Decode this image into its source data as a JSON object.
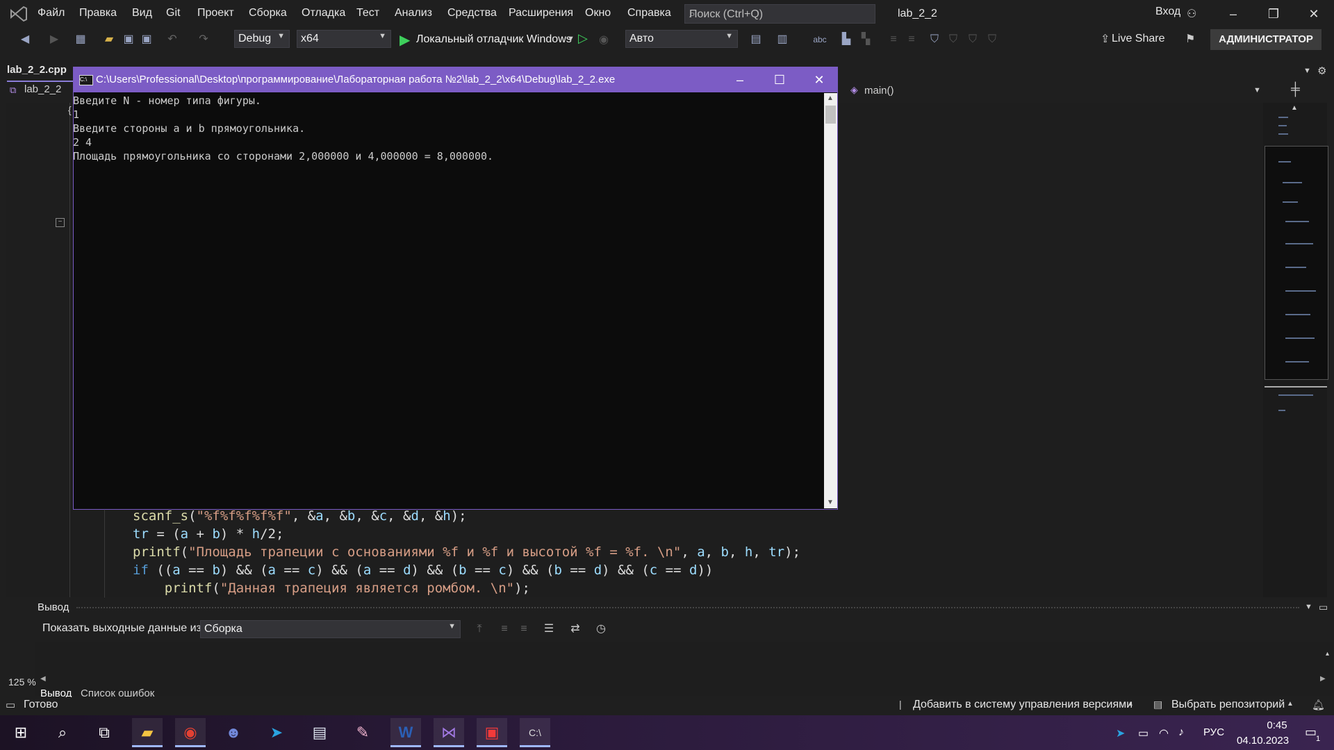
{
  "menu": {
    "items": [
      "Файл",
      "Правка",
      "Вид",
      "Git",
      "Проект",
      "Сборка",
      "Отладка",
      "Тест",
      "Анализ",
      "Средства",
      "Расширения",
      "Окно",
      "Справка"
    ],
    "search_placeholder": "Поиск (Ctrl+Q)",
    "solution_name": "lab_2_2",
    "login": "Вход"
  },
  "toolbar": {
    "config": "Debug",
    "platform": "x64",
    "debugger": "Локальный отладчик Windows",
    "auto": "Авто",
    "live_share": "Live Share",
    "admin": "АДМИНИСТРАТОР"
  },
  "editor": {
    "file_tab": "lab_2_2.cpp",
    "project": "lab_2_2",
    "scope": "main()",
    "code_lines": [
      "scanf_s(\"%f%f%f%f%f\", &a, &b, &c, &d, &h);",
      "tr = (a + b) * h/2;",
      "printf(\"Площадь трапеции с основаниями %f и %f и высотой %f = %f. \\n\", a, b, h, tr);",
      "if ((a == b) && (a == c) && (a == d) && (b == c) && (b == d) && (c == d))",
      "    printf(\"Данная трапеция является ромбом. \\n\");"
    ]
  },
  "console": {
    "title": "C:\\Users\\Professional\\Desktop\\программирование\\Лабораторная работа №2\\lab_2_2\\x64\\Debug\\lab_2_2.exe",
    "lines": [
      "Введите N - номер типа фигуры.",
      "1",
      "Введите стороны a и b прямоугольника.",
      "2 4",
      "Площадь прямоугольника со сторонами 2,000000 и 4,000000 = 8,000000."
    ]
  },
  "output": {
    "title": "Вывод",
    "show_label": "Показать выходные данные из:",
    "source": "Сборка",
    "zoom": "125 %",
    "tabs": [
      "Вывод",
      "Список ошибок"
    ]
  },
  "status": {
    "ready": "Готово",
    "vcs": "Добавить в систему управления версиями",
    "repo": "Выбрать репозиторий"
  },
  "taskbar": {
    "lang": "РУС",
    "time": "0:45",
    "date": "04.10.2023",
    "notif_count": "1"
  }
}
